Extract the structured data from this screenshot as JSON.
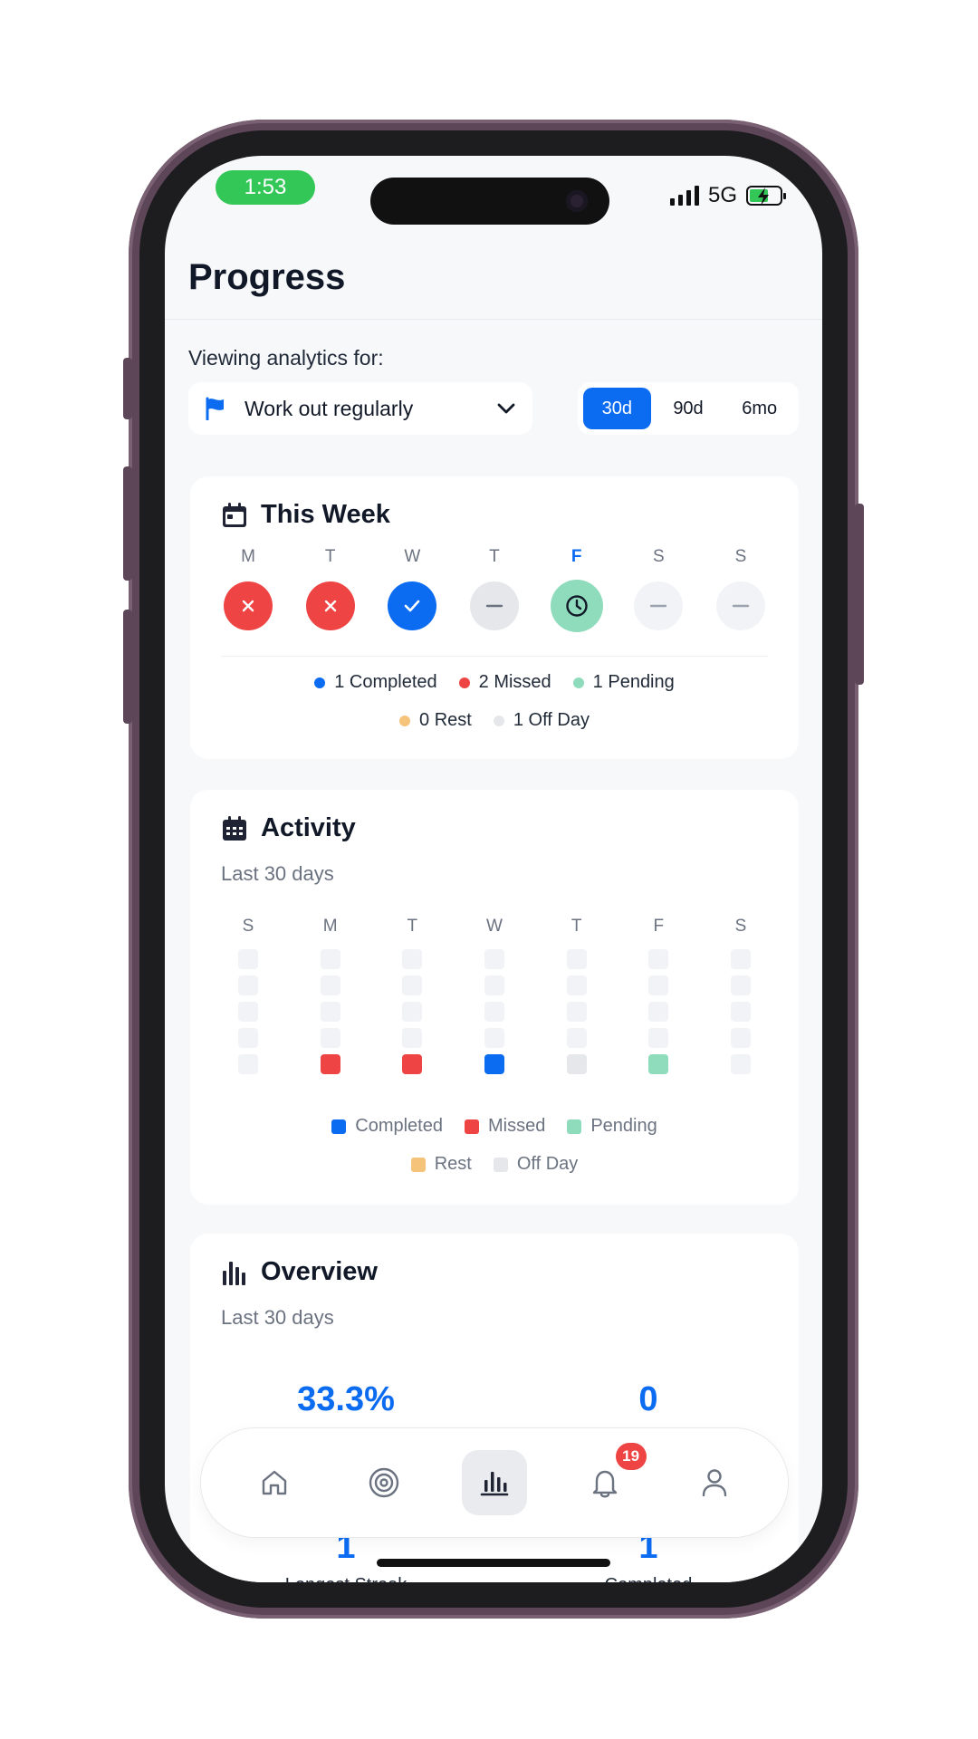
{
  "status_bar": {
    "time": "1:53",
    "network": "5G"
  },
  "header": {
    "title": "Progress"
  },
  "filters": {
    "viewing_label": "Viewing analytics for:",
    "goal": "Work out regularly",
    "ranges": [
      {
        "label": "30d",
        "active": true
      },
      {
        "label": "90d",
        "active": false
      },
      {
        "label": "6mo",
        "active": false
      }
    ]
  },
  "this_week": {
    "title": "This Week",
    "days": [
      {
        "label": "M",
        "status": "missed"
      },
      {
        "label": "T",
        "status": "missed"
      },
      {
        "label": "W",
        "status": "completed"
      },
      {
        "label": "T",
        "status": "off"
      },
      {
        "label": "F",
        "status": "pending",
        "today": true
      },
      {
        "label": "S",
        "status": "none"
      },
      {
        "label": "S",
        "status": "none"
      }
    ],
    "legend": {
      "completed": "1 Completed",
      "missed": "2 Missed",
      "pending": "1 Pending",
      "rest": "0 Rest",
      "off": "1 Off Day"
    }
  },
  "activity": {
    "title": "Activity",
    "subtitle": "Last 30 days",
    "day_headers": [
      "S",
      "M",
      "T",
      "W",
      "T",
      "F",
      "S"
    ],
    "last_row": [
      "empty",
      "missed",
      "missed",
      "completed",
      "off",
      "pending",
      "empty"
    ],
    "legend": {
      "completed": "Completed",
      "missed": "Missed",
      "pending": "Pending",
      "rest": "Rest",
      "off": "Off Day"
    }
  },
  "overview": {
    "title": "Overview",
    "subtitle": "Last 30 days",
    "stats": [
      {
        "value": "33.3%"
      },
      {
        "value": "0"
      },
      {
        "value": "1",
        "label": "Longest Streak"
      },
      {
        "value": "1",
        "label": "Completed"
      }
    ]
  },
  "tab_bar": {
    "tabs": [
      "home",
      "goals",
      "progress",
      "notifications",
      "profile"
    ],
    "active": "progress",
    "notification_count": "19"
  },
  "colors": {
    "accent": "#0b6cf2",
    "completed": "#0b6cf2",
    "missed": "#ef4444",
    "pending": "#8fdcbc",
    "rest": "#f6c37a",
    "off": "#e5e7eb",
    "none": "#f1f3f6"
  }
}
